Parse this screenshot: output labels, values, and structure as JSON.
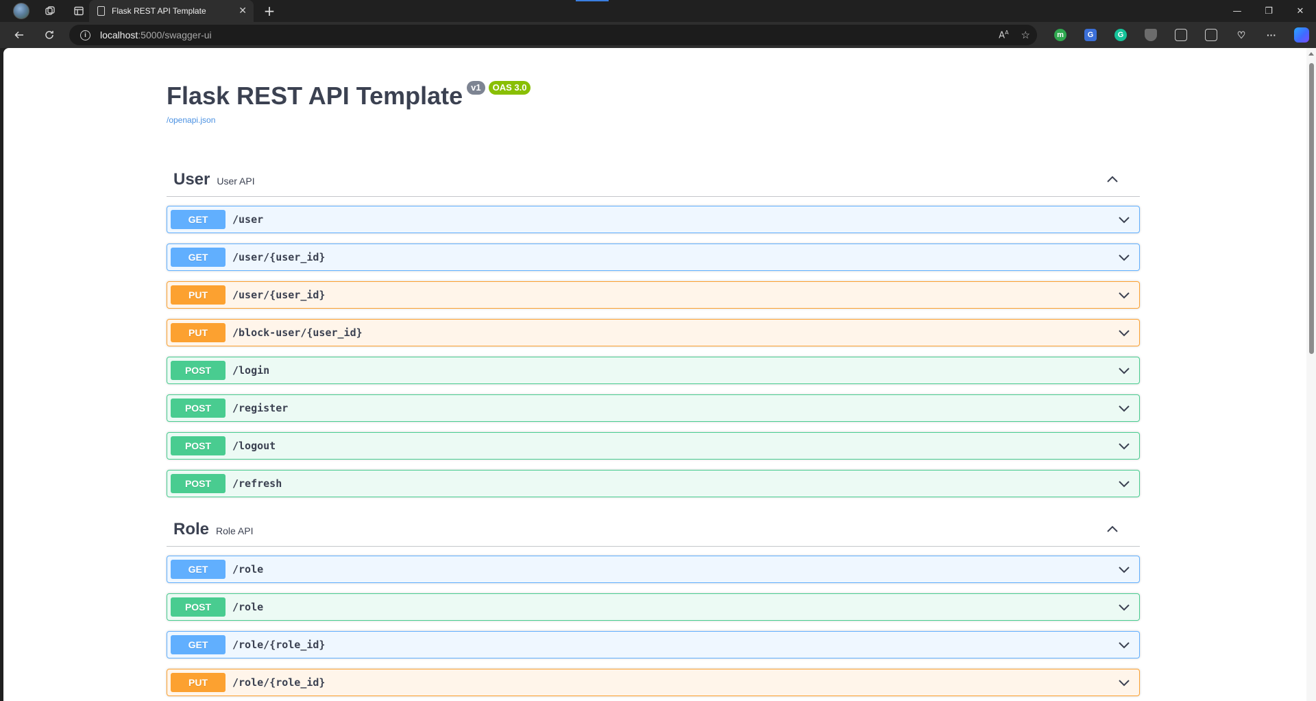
{
  "browser": {
    "tab_title": "Flask REST API Template",
    "url_host": "localhost",
    "url_path": ":5000/swagger-ui"
  },
  "info": {
    "title": "Flask REST API Template",
    "version": "v1",
    "oas": "OAS 3.0",
    "spec_link": "/openapi.json"
  },
  "tags": [
    {
      "name": "User",
      "description": "User API",
      "operations": [
        {
          "method": "GET",
          "path": "/user"
        },
        {
          "method": "GET",
          "path": "/user/{user_id}"
        },
        {
          "method": "PUT",
          "path": "/user/{user_id}"
        },
        {
          "method": "PUT",
          "path": "/block-user/{user_id}"
        },
        {
          "method": "POST",
          "path": "/login"
        },
        {
          "method": "POST",
          "path": "/register"
        },
        {
          "method": "POST",
          "path": "/logout"
        },
        {
          "method": "POST",
          "path": "/refresh"
        }
      ]
    },
    {
      "name": "Role",
      "description": "Role API",
      "operations": [
        {
          "method": "GET",
          "path": "/role"
        },
        {
          "method": "POST",
          "path": "/role"
        },
        {
          "method": "GET",
          "path": "/role/{role_id}"
        },
        {
          "method": "PUT",
          "path": "/role/{role_id}"
        }
      ]
    }
  ],
  "colors": {
    "get": "#61affe",
    "put": "#fca130",
    "post": "#49cc90",
    "text": "#3b4151",
    "link": "#4990e2"
  }
}
